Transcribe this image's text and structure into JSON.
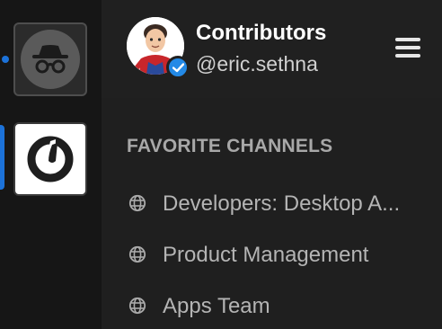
{
  "header": {
    "title": "Contributors",
    "username": "@eric.sethna"
  },
  "teams": [
    {
      "icon": "incognito-icon",
      "selected": false,
      "has_unread": true
    },
    {
      "icon": "mattermost-logo-icon",
      "selected": true,
      "has_unread": false
    }
  ],
  "favorites": {
    "heading": "FAVORITE CHANNELS",
    "channels": [
      {
        "label": "Developers: Desktop A...",
        "icon": "globe-icon"
      },
      {
        "label": "Product Management",
        "icon": "globe-icon"
      },
      {
        "label": "Apps Team",
        "icon": "globe-icon"
      }
    ]
  },
  "colors": {
    "accent": "#1c72d9",
    "verified_badge": "#2389e6",
    "panel_bg": "#1f1f1f",
    "sidebar_bg": "#161616"
  }
}
